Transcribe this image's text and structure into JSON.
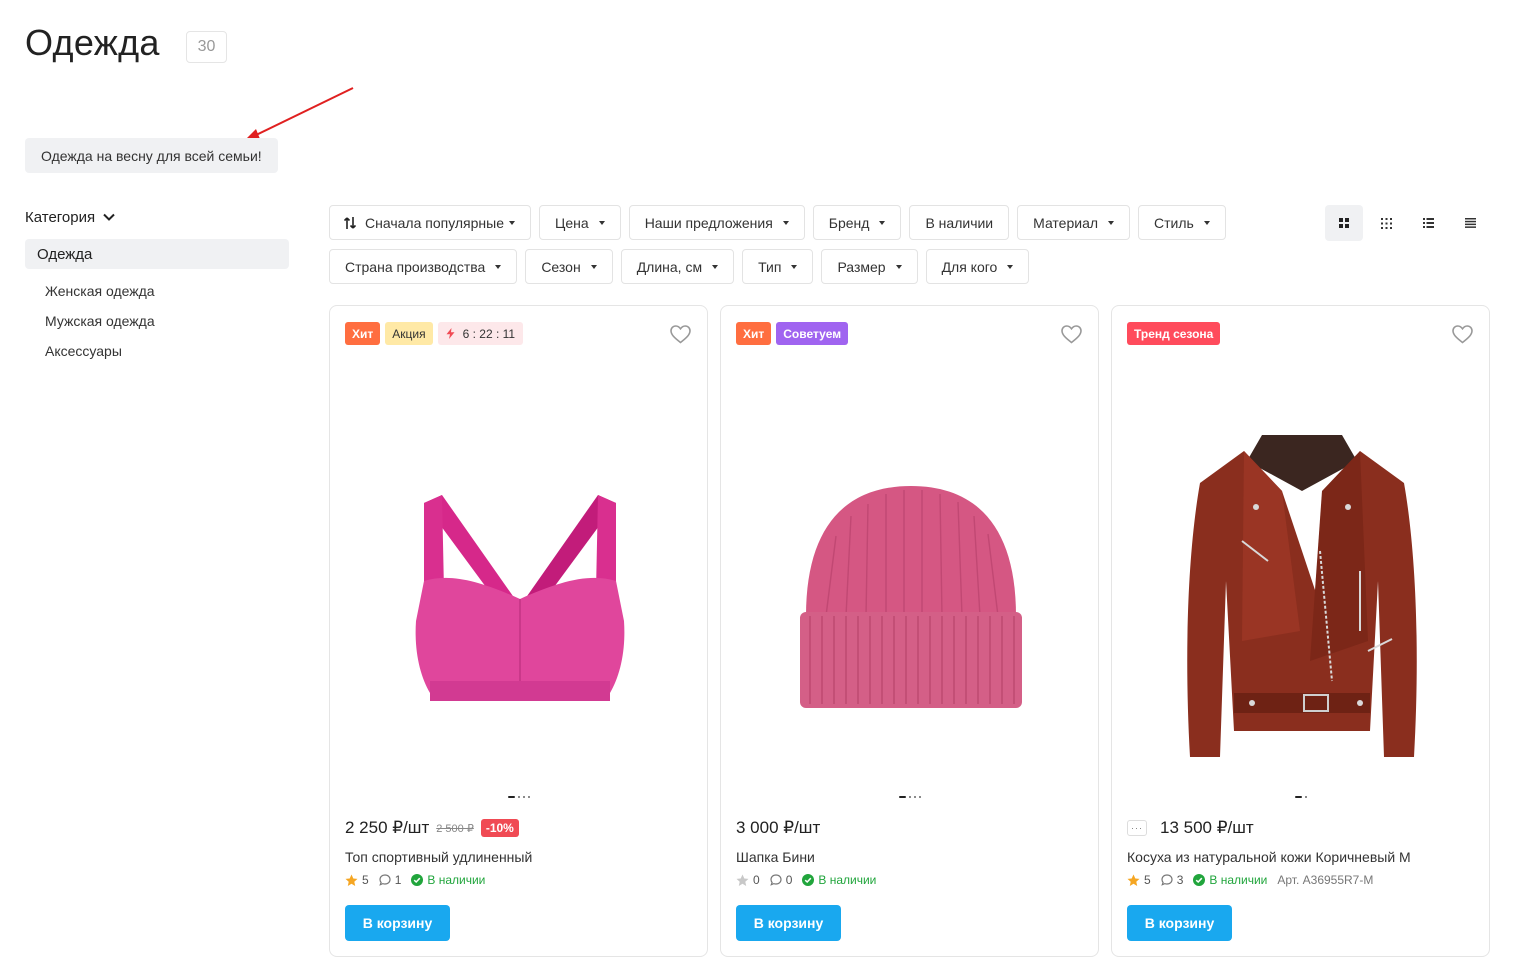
{
  "page": {
    "title": "Одежда",
    "count": "30"
  },
  "promo_tag": "Одежда на весну для всей семьи!",
  "sidebar": {
    "header": "Категория",
    "active": "Одежда",
    "items": [
      "Женская одежда",
      "Мужская одежда",
      "Аксессуары"
    ]
  },
  "filters": {
    "row1": [
      "Сначала популярные",
      "Цена",
      "Наши предложения",
      "Бренд",
      "В наличии",
      "Материал",
      "Стиль"
    ],
    "row2": [
      "Страна производства",
      "Сезон",
      "Длина, см",
      "Тип",
      "Размер",
      "Для кого"
    ]
  },
  "colors": {
    "accent": "#19a8ef",
    "hit": "#ff6e40",
    "promo": "#ffe9a6",
    "advice": "#a064f0",
    "trend": "#ff4b5c",
    "available": "#21a53c",
    "discount": "#f04a54"
  },
  "products": [
    {
      "badges": [
        "Хит",
        "Акция"
      ],
      "timer": "6 : 22 : 11",
      "price": "2 250 ₽/шт",
      "old_price": "2 500 ₽",
      "discount": "-10%",
      "name": "Топ спортивный удлиненный",
      "rating": "5",
      "reviews": "1",
      "availability": "В наличии",
      "cart": "В корзину",
      "image": "pink-sports-bra"
    },
    {
      "badges": [
        "Хит",
        "Советуем"
      ],
      "price": "3 000 ₽/шт",
      "name": "Шапка Бини",
      "rating": "0",
      "reviews": "0",
      "availability": "В наличии",
      "cart": "В корзину",
      "image": "pink-beanie"
    },
    {
      "badges": [
        "Тренд сезона"
      ],
      "price": "13 500 ₽/шт",
      "name": "Косуха из натуральной кожи Коричневый М",
      "rating": "5",
      "reviews": "3",
      "availability": "В наличии",
      "article": "Арт. A36955R7-M",
      "cart": "В корзину",
      "image": "brown-leather-jacket"
    }
  ]
}
